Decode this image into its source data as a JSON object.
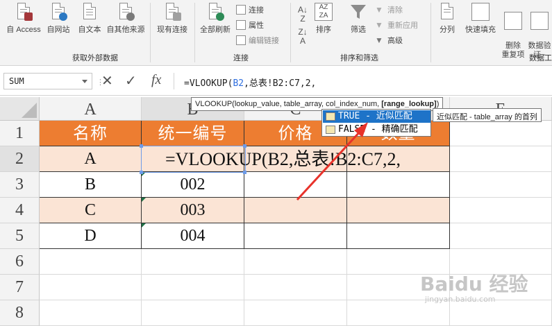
{
  "ribbon": {
    "get_external": {
      "label": "获取外部数据",
      "buttons": [
        {
          "label": "自 Access",
          "icon": "access-icon",
          "color": "#a4373a"
        },
        {
          "label": "自网站",
          "icon": "web-icon",
          "color": "#2b78c2"
        },
        {
          "label": "自文本",
          "icon": "text-file-icon",
          "color": "#5a5a5a"
        },
        {
          "label": "自其他来源",
          "icon": "other-sources-icon",
          "color": "#5a5a5a"
        },
        {
          "label": "现有连接",
          "icon": "existing-connection-icon",
          "color": "#5a5a5a"
        }
      ]
    },
    "connections": {
      "label": "连接",
      "refresh_label": "全部刷新",
      "small": [
        "连接",
        "属性",
        "编辑链接"
      ]
    },
    "sort_filter": {
      "label": "排序和筛选",
      "sort_label": "排序",
      "filter_label": "筛选",
      "small": [
        "清除",
        "重新应用",
        "高级"
      ]
    },
    "data_tools": {
      "label": "数据工",
      "buttons": [
        "分列",
        "快速填充",
        "删除\n重复项",
        "数据验\n证 -"
      ]
    }
  },
  "formula_bar": {
    "name_box": "SUM",
    "cancel_symbol": "✕",
    "enter_symbol": "✓",
    "fx_symbol": "fx",
    "formula_prefix": "=VLOOKUP(",
    "formula_ref": "B2",
    "formula_rest": ",总表!B2:C7,2,"
  },
  "grid": {
    "columns": [
      "A",
      "B",
      "C",
      "D",
      "E"
    ],
    "rows": [
      "1",
      "2",
      "3",
      "4",
      "5",
      "6",
      "7",
      "8"
    ],
    "header_row": [
      "名称",
      "统一编号",
      "价格",
      "数量"
    ],
    "data": [
      [
        "A",
        "",
        "",
        ""
      ],
      [
        "B",
        "002",
        "",
        ""
      ],
      [
        "C",
        "003",
        "",
        ""
      ],
      [
        "D",
        "004",
        "",
        ""
      ]
    ],
    "editing_text": "=VLOOKUP(B2,总表!B2:C7,2,",
    "accent_header": "#ed7d31",
    "accent_band": "#fbe4d5"
  },
  "tooltip": {
    "prefix": "VLOOKUP(lookup_value, table_array, col_index_num, ",
    "bold": "[range_lookup]",
    "suffix": ")"
  },
  "autocomplete": {
    "items": [
      "TRUE - 近似匹配",
      "FALSE - 精确匹配"
    ],
    "selected": 0,
    "side_tip": "近似匹配 - table_array 的首列"
  },
  "watermark": {
    "text": "Baidu 经验",
    "sub": "jingyan.baidu.com"
  }
}
